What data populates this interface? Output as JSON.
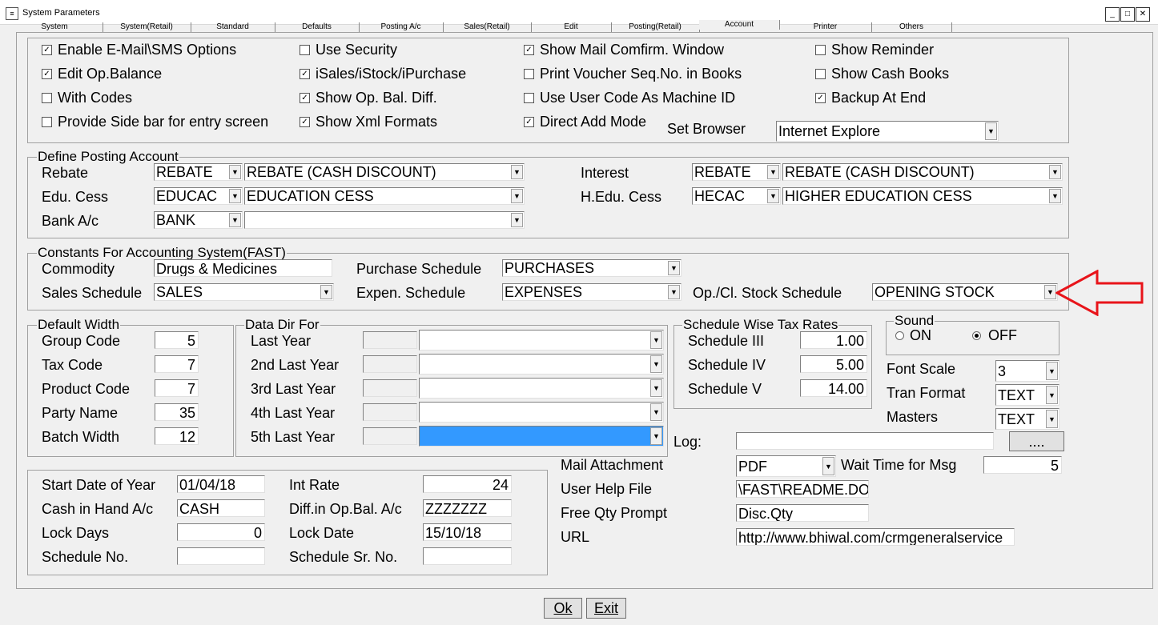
{
  "window": {
    "title": "System Parameters"
  },
  "tabs": [
    "System",
    "System(Retail)",
    "Standard",
    "Defaults",
    "Posting A/c",
    "Sales(Retail)",
    "Edit",
    "Posting(Retail)",
    "Account",
    "Printer",
    "Others"
  ],
  "options": {
    "enable_email": "Enable E-Mail\\SMS Options",
    "use_security": "Use Security",
    "show_mail": "Show Mail Comfirm. Window",
    "show_reminder": "Show Reminder",
    "edit_opbal": "Edit Op.Balance",
    "isales": "iSales/iStock/iPurchase",
    "print_voucher": "Print Voucher Seq.No. in Books",
    "show_cash": "Show Cash Books",
    "with_codes": "With Codes",
    "show_opbal": "Show Op. Bal. Diff.",
    "use_usercode": "Use User Code As Machine ID",
    "backup": "Backup At End",
    "side_bar": "Provide Side bar for entry screen",
    "show_xml": "Show Xml Formats",
    "direct_add": "Direct Add Mode",
    "set_browser": "Set Browser",
    "browser_value": "Internet Explore"
  },
  "posting": {
    "title": "Define Posting Account",
    "rebate": "Rebate",
    "rebate_code": "REBATE",
    "rebate_name": "REBATE (CASH DISCOUNT)",
    "edu": "Edu. Cess",
    "edu_code": "EDUCAC",
    "edu_name": "EDUCATION CESS",
    "bank": "Bank A/c",
    "bank_code": "BANK",
    "bank_name": "",
    "interest": "Interest",
    "interest_code": "REBATE",
    "interest_name": "REBATE (CASH DISCOUNT)",
    "hedu": "H.Edu. Cess",
    "hedu_code": "HECAC",
    "hedu_name": "HIGHER EDUCATION CESS"
  },
  "constants": {
    "title": "Constants For Accounting System(FAST)",
    "commodity": "Commodity",
    "commodity_value": "Drugs & Medicines",
    "sales": "Sales Schedule",
    "sales_value": "SALES",
    "purchase": "Purchase Schedule",
    "purchase_value": "PURCHASES",
    "expen": "Expen. Schedule",
    "expen_value": "EXPENSES",
    "stock": "Op./Cl. Stock Schedule",
    "stock_value": "OPENING STOCK"
  },
  "width": {
    "title": "Default Width",
    "group": "Group Code",
    "group_v": "5",
    "tax": "Tax Code",
    "tax_v": "7",
    "product": "Product Code",
    "product_v": "7",
    "party": "Party Name",
    "party_v": "35",
    "batch": "Batch Width",
    "batch_v": "12"
  },
  "datadir": {
    "title": "Data Dir For",
    "y1": "Last Year",
    "y2": "2nd Last Year",
    "y3": "3rd Last Year",
    "y4": "4th Last Year",
    "y5": "5th Last Year"
  },
  "taxrates": {
    "title": "Schedule Wise Tax Rates",
    "s3": "Schedule III",
    "s3v": "1.00",
    "s4": "Schedule IV",
    "s4v": "5.00",
    "s5": "Schedule V",
    "s5v": "14.00"
  },
  "sound": {
    "title": "Sound",
    "on": "ON",
    "off": "OFF"
  },
  "misc": {
    "font_scale": "Font Scale",
    "font_scale_v": "3",
    "tran_format": "Tran Format",
    "tran_format_v": "TEXT",
    "masters": "Masters",
    "masters_v": "TEXT",
    "log": "Log:",
    "log_btn": "....",
    "mail": "Mail Attachment",
    "mail_v": "PDF",
    "wait": "Wait Time for Msg",
    "wait_v": "5",
    "help": "User Help File",
    "help_v": "\\FAST\\README.DO",
    "freeqty": "Free Qty Prompt",
    "freeqty_v": "Disc.Qty",
    "url": "URL",
    "url_v": "http://www.bhiwal.com/crmgeneralservice"
  },
  "dates": {
    "start": "Start Date of Year",
    "start_v": "01/04/18",
    "cash": "Cash in Hand A/c",
    "cash_v": "CASH",
    "lockdays": "Lock Days",
    "lockdays_v": "0",
    "schedno": "Schedule No.",
    "schedno_v": "",
    "intrate": "Int Rate",
    "intrate_v": "24",
    "diff": "Diff.in Op.Bal. A/c",
    "diff_v": "ZZZZZZZ",
    "lockdate": "Lock Date",
    "lockdate_v": "15/10/18",
    "schedsr": "Schedule Sr. No.",
    "schedsr_v": ""
  },
  "buttons": {
    "ok": "Ok",
    "exit": "Exit"
  },
  "accent": {
    "arrow": "#e8141a",
    "selection": "#3399ff"
  }
}
